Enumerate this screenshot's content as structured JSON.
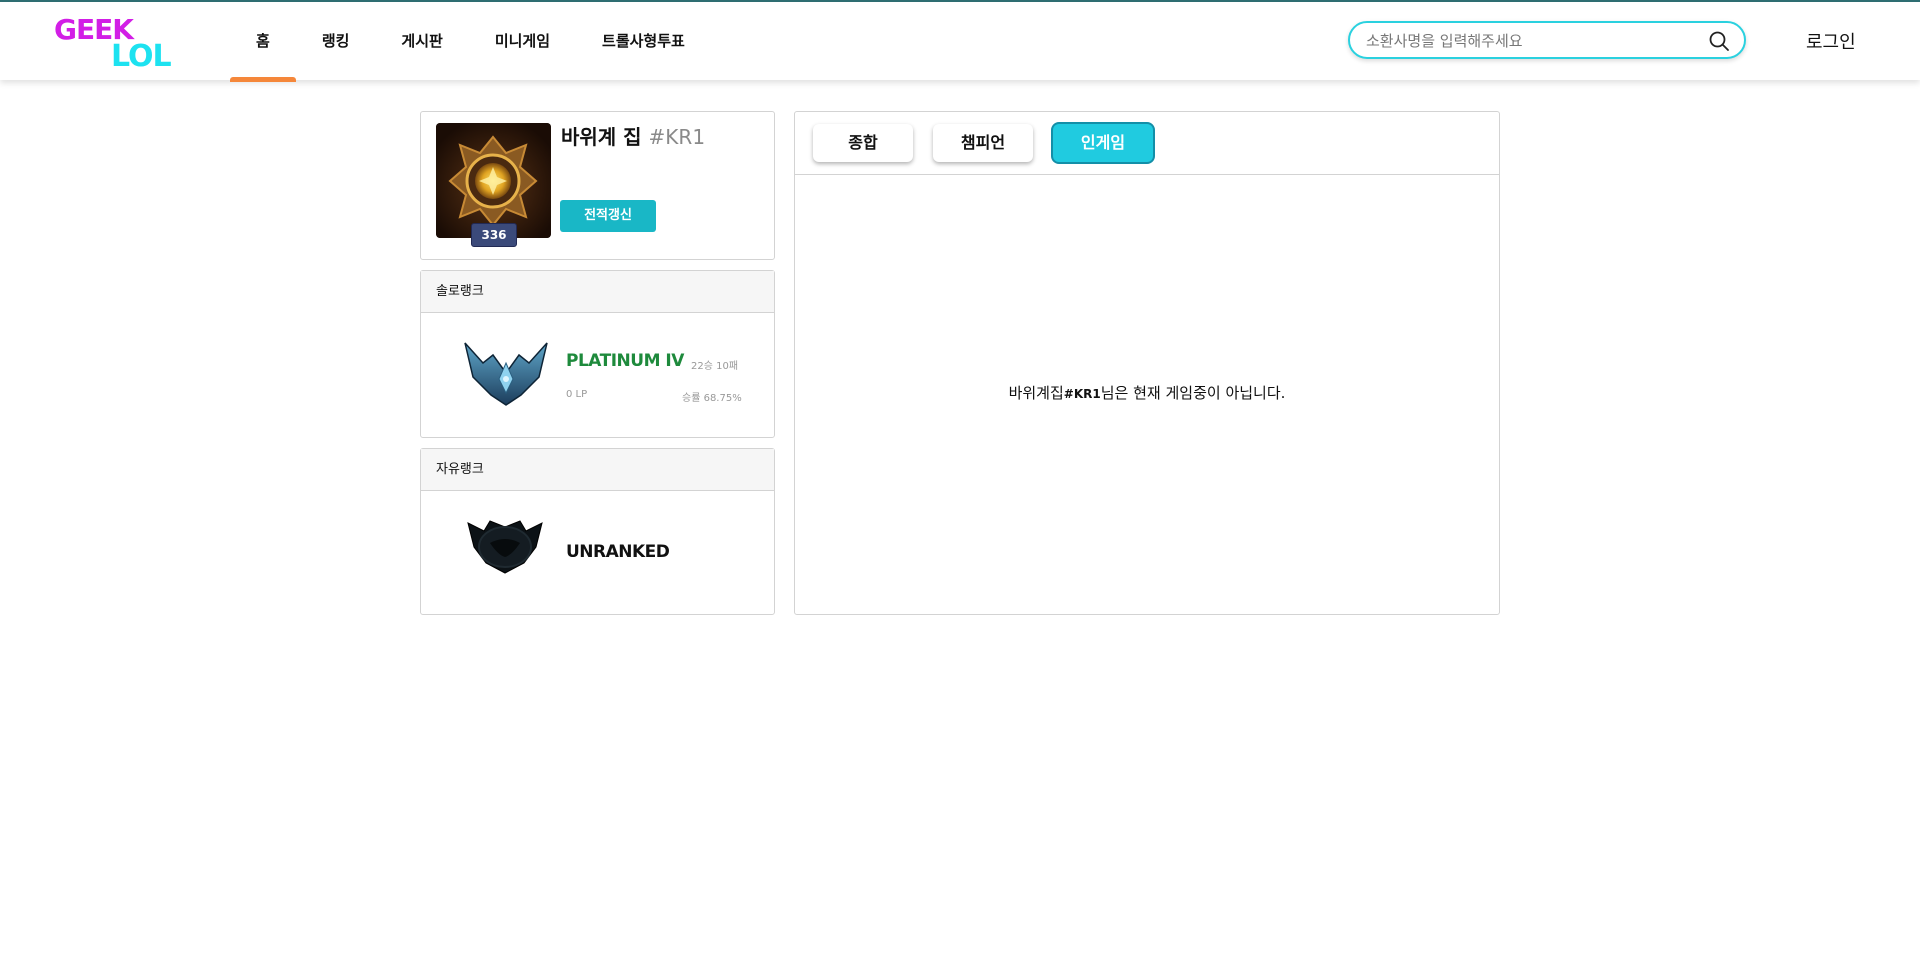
{
  "header": {
    "logo_line1": "GEEK",
    "logo_line2": "LOL",
    "nav": [
      "홈",
      "랭킹",
      "게시판",
      "미니게임",
      "트롤사형투표"
    ],
    "active_nav": "홈",
    "search_placeholder": "소환사명을 입력해주세요",
    "login_label": "로그인"
  },
  "profile": {
    "name": "바위계 집",
    "tag": "#KR1",
    "level": "336",
    "refresh_label": "전적갱신"
  },
  "solo_rank": {
    "title": "솔로랭크",
    "tier": "PLATINUM IV",
    "tier_color": "#1e8a3c",
    "record": "22승 10패",
    "lp": "0 LP",
    "win_rate": "승률 68.75%"
  },
  "flex_rank": {
    "title": "자유랭크",
    "tier": "UNRANKED"
  },
  "tabs": [
    "종합",
    "챔피언",
    "인게임"
  ],
  "active_tab": "인게임",
  "ingame": {
    "name": "바위계집",
    "tag": "#KR1",
    "suffix": "님은 현재 게임중이 아닙니다."
  },
  "colors": {
    "accent": "#20cbe0",
    "nav_indicator": "#f5873a",
    "logo_pink": "#d21ee6",
    "logo_cyan": "#1de2f0"
  }
}
